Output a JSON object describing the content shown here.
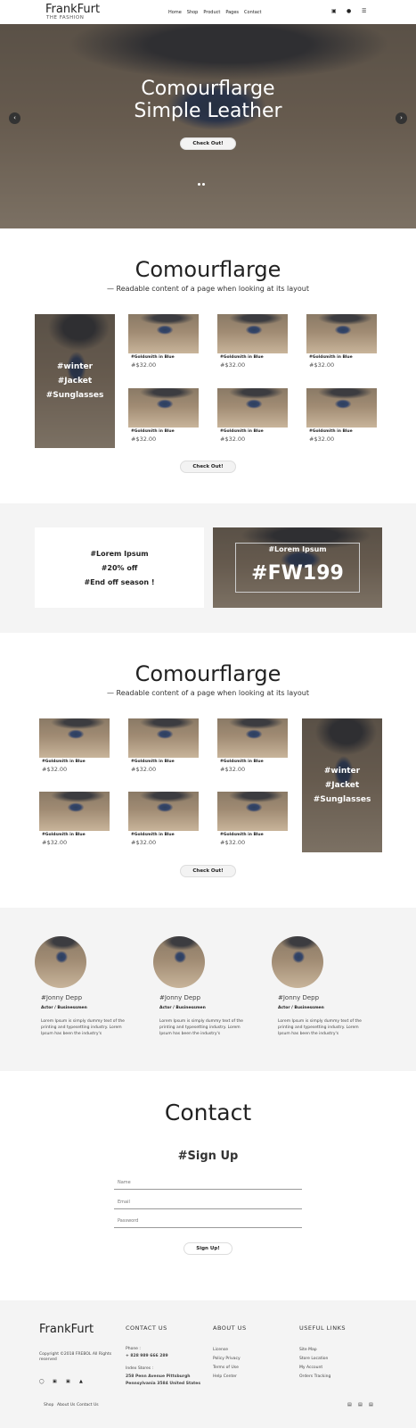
{
  "header": {
    "brand": "FrankFurt",
    "tagline": "THE FASHION",
    "nav": [
      "Home",
      "Shop",
      "Product",
      "Pages",
      "Contact"
    ]
  },
  "hero": {
    "line1": "Comourflarge",
    "line2": "Simple Leather",
    "button": "Check Out!"
  },
  "section1": {
    "title": "Comourflarge",
    "subtitle": "— Readable content of a page when looking at its layout",
    "tags": [
      "#winter",
      "#Jacket",
      "#Sunglasses"
    ],
    "products": [
      {
        "name": "#Goldsmith in Blue",
        "price": "#$32.00"
      },
      {
        "name": "#Goldsmith in Blue",
        "price": "#$32.00"
      },
      {
        "name": "#Goldsmith in Blue",
        "price": "#$32.00"
      },
      {
        "name": "#Goldsmith in Blue",
        "price": "#$32.00"
      },
      {
        "name": "#Goldsmith in Blue",
        "price": "#$32.00"
      },
      {
        "name": "#Goldsmith in Blue",
        "price": "#$32.00"
      }
    ],
    "button": "Check Out!"
  },
  "promo": {
    "left": [
      "#Lorem Ipsum",
      "#20% off",
      "#End off season !"
    ],
    "right_small": "#Lorem Ipsum",
    "right_big": "#FW199"
  },
  "section2": {
    "title": "Comourflarge",
    "subtitle": "— Readable content of a page when looking at its layout",
    "tags": [
      "#winter",
      "#Jacket",
      "#Sunglasses"
    ],
    "products": [
      {
        "name": "#Goldsmith in Blue",
        "price": "#$32.00"
      },
      {
        "name": "#Goldsmith in Blue",
        "price": "#$32.00"
      },
      {
        "name": "#Goldsmith in Blue",
        "price": "#$32.00"
      },
      {
        "name": "#Goldsmith in Blue",
        "price": "#$32.00"
      },
      {
        "name": "#Goldsmith in Blue",
        "price": "#$32.00"
      },
      {
        "name": "#Goldsmith in Blue",
        "price": "#$32.00"
      }
    ],
    "button": "Check Out!"
  },
  "team": [
    {
      "name": "#Jonny Depp",
      "role": "Actor / Businessmen",
      "desc": "Lorem Ipsum is simply dummy text of the printing and typesetting industry. Lorem Ipsum has been the industry's"
    },
    {
      "name": "#Jonny Depp",
      "role": "Actor / Businessmen",
      "desc": "Lorem Ipsum is simply dummy text of the printing and typesetting industry. Lorem Ipsum has been the industry's"
    },
    {
      "name": "#Jonny Depp",
      "role": "Actor / Businessmen",
      "desc": "Lorem Ipsum is simply dummy text of the printing and typesetting industry. Lorem Ipsum has been the industry's"
    }
  ],
  "contact": {
    "title": "Contact",
    "signup": "#Sign Up",
    "name_ph": "Name",
    "email_ph": "Email",
    "password_ph": "Password",
    "button": "Sign Up!"
  },
  "footer": {
    "brand": "FrankFurt",
    "copyright": "Copyright ©2018 FREBOL All Rights reserved",
    "contact_head": "CONTACT US",
    "phone_label": "Phone :",
    "phone": "+ 828 989 666 289",
    "index_label": "Index Stores :",
    "address1": "258 Penn Avenue Pittsburgh",
    "address2": "Pennsylvania 3584 United States",
    "about_head": "ABOUT US",
    "about": [
      "License",
      "Policy Privacy",
      "Terms of Use",
      "Help Center"
    ],
    "links_head": "USEFUL LINKS",
    "links": [
      "Site Map",
      "Store Location",
      "My Account",
      "Orders Tracking"
    ],
    "bottom_nav": [
      "Shop",
      "About Us",
      "Contact Us"
    ]
  }
}
